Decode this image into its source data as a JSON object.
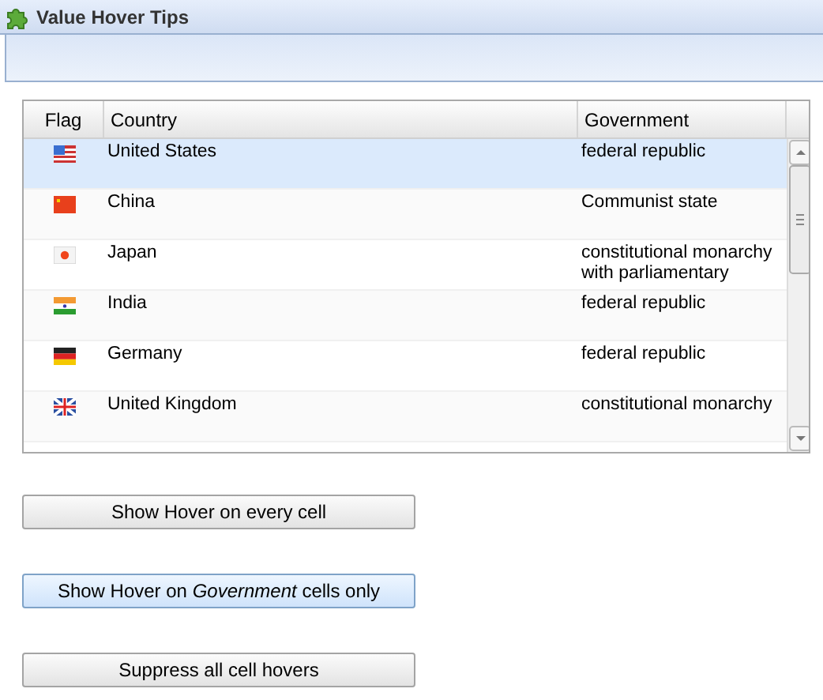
{
  "window": {
    "title": "Value Hover Tips"
  },
  "grid": {
    "columns": [
      "Flag",
      "Country",
      "Government"
    ],
    "rows": [
      {
        "country": "United States",
        "government": "federal republic",
        "selected": true
      },
      {
        "country": "China",
        "government": "Communist state",
        "selected": false
      },
      {
        "country": "Japan",
        "government": "constitutional monarchy with parliamentary",
        "selected": false
      },
      {
        "country": "India",
        "government": "federal republic",
        "selected": false
      },
      {
        "country": "Germany",
        "government": "federal republic",
        "selected": false
      },
      {
        "country": "United Kingdom",
        "government": "constitutional monarchy",
        "selected": false
      }
    ]
  },
  "buttons": [
    {
      "label": "Show Hover on every cell",
      "selected": false
    },
    {
      "label": "Show Hover on *Government* cells only",
      "selected": true
    },
    {
      "label": "Suppress all cell hovers",
      "selected": false
    }
  ]
}
